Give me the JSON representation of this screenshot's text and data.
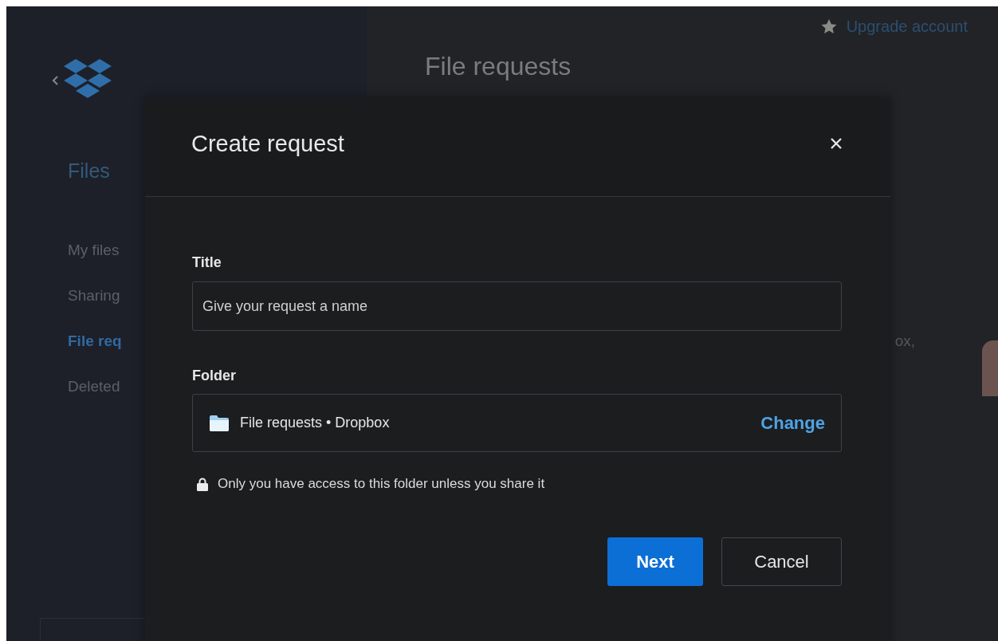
{
  "top_bar": {
    "upgrade_link": "Upgrade account"
  },
  "page": {
    "heading": "File requests",
    "body_fragment": "ox,"
  },
  "sidebar": {
    "section": "Files",
    "items": [
      {
        "label": "My files",
        "selected": false
      },
      {
        "label": "Sharing",
        "selected": false
      },
      {
        "label": "File req",
        "selected": true
      },
      {
        "label": "Deleted",
        "selected": false
      }
    ]
  },
  "dialog": {
    "title": "Create request",
    "title_field": {
      "label": "Title",
      "placeholder": "Give your request a name"
    },
    "folder_field": {
      "label": "Folder",
      "value": "File requests • Dropbox",
      "action": "Change"
    },
    "note": "Only you have access to this folder unless you share it",
    "buttons": [
      {
        "label": "Next",
        "kind": "primary"
      },
      {
        "label": "Cancel",
        "kind": "secondary"
      }
    ]
  }
}
